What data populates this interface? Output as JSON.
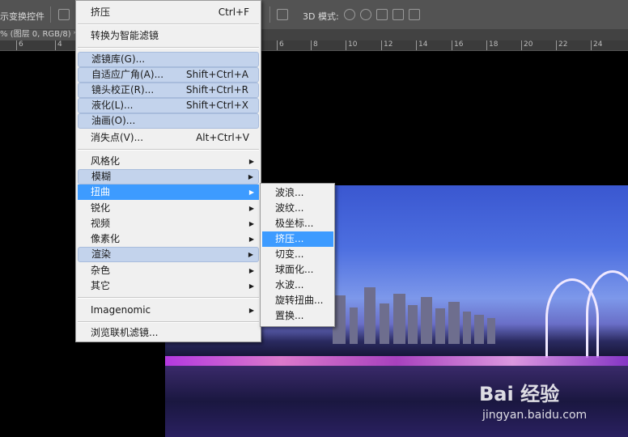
{
  "optbar": {
    "left_label": "示变换控件",
    "mode_label": "3D 模式:"
  },
  "tab": {
    "doc_label": "% (图层 0, RGB/8) *"
  },
  "ruler": {
    "ticks": [
      "6",
      "4",
      "6",
      "8",
      "10",
      "12",
      "14",
      "16",
      "18",
      "20",
      "22",
      "24"
    ]
  },
  "menu": {
    "items": [
      {
        "label": "挤压",
        "shortcut": "Ctrl+F"
      },
      {
        "label": "转换为智能滤镜"
      },
      {
        "label": "滤镜库(G)..."
      },
      {
        "label": "自适应广角(A)...",
        "shortcut": "Shift+Ctrl+A"
      },
      {
        "label": "镜头校正(R)...",
        "shortcut": "Shift+Ctrl+R"
      },
      {
        "label": "液化(L)...",
        "shortcut": "Shift+Ctrl+X"
      },
      {
        "label": "油画(O)..."
      },
      {
        "label": "消失点(V)...",
        "shortcut": "Alt+Ctrl+V"
      },
      {
        "label": "风格化"
      },
      {
        "label": "模糊"
      },
      {
        "label": "扭曲"
      },
      {
        "label": "锐化"
      },
      {
        "label": "视频"
      },
      {
        "label": "像素化"
      },
      {
        "label": "渲染"
      },
      {
        "label": "杂色"
      },
      {
        "label": "其它"
      },
      {
        "label": "Imagenomic"
      },
      {
        "label": "浏览联机滤镜..."
      }
    ]
  },
  "submenu": {
    "items": [
      {
        "label": "波浪..."
      },
      {
        "label": "波纹..."
      },
      {
        "label": "极坐标..."
      },
      {
        "label": "挤压..."
      },
      {
        "label": "切变..."
      },
      {
        "label": "球面化..."
      },
      {
        "label": "水波..."
      },
      {
        "label": "旋转扭曲..."
      },
      {
        "label": "置换..."
      }
    ]
  },
  "watermark": {
    "brand": "Bai 经验",
    "url": "jingyan.baidu.com"
  },
  "colors": {
    "highlight": "#3d9bff",
    "group": "#c3d3ec"
  }
}
